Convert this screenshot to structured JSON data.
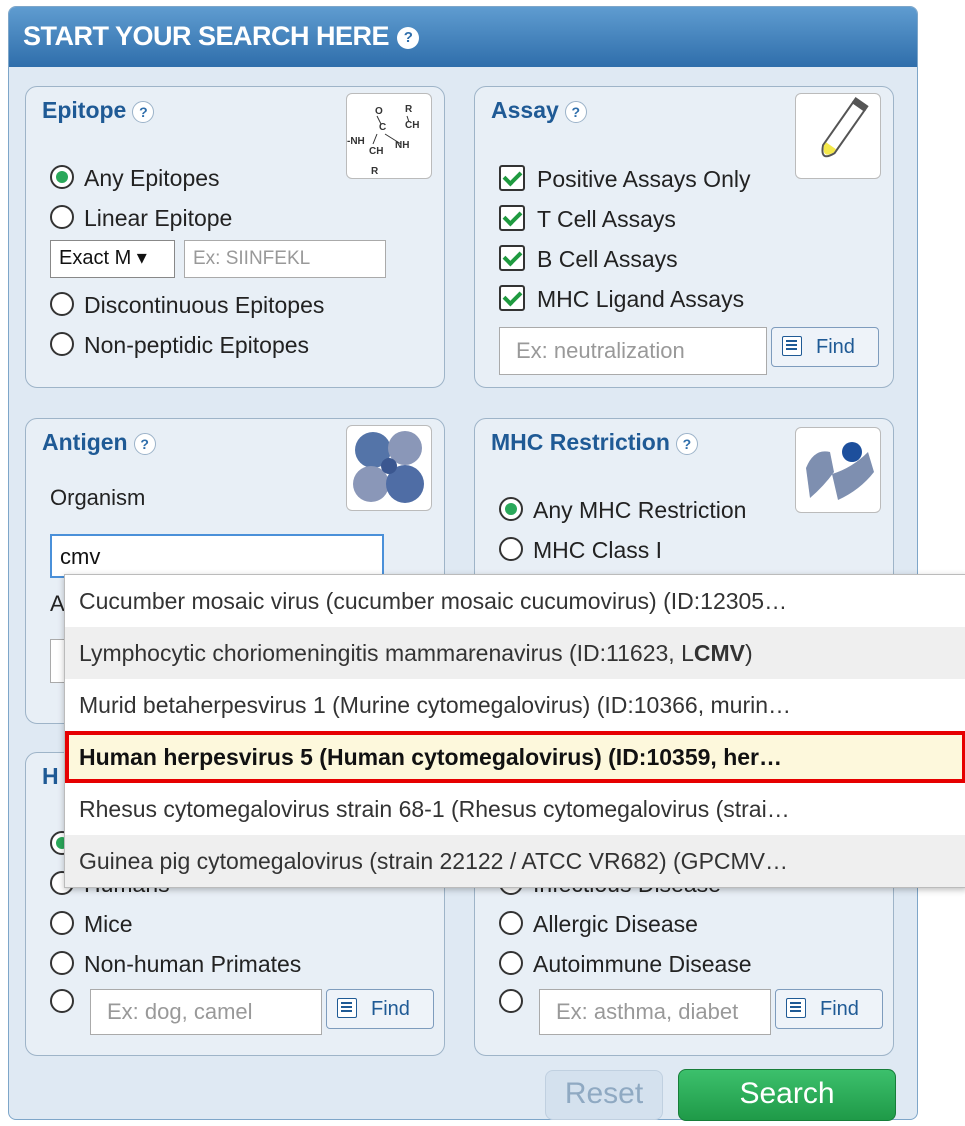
{
  "header": {
    "title": "START YOUR SEARCH HERE",
    "help": "?"
  },
  "epitope": {
    "title": "Epitope",
    "help": "?",
    "options": [
      "Any Epitopes",
      "Linear Epitope",
      "Discontinuous Epitopes",
      "Non-peptidic Epitopes"
    ],
    "selected": "Any Epitopes",
    "match_select": "Exact M ▾",
    "sequence_placeholder": "Ex: SIINFEKL"
  },
  "assay": {
    "title": "Assay",
    "help": "?",
    "checks": [
      "Positive Assays Only",
      "T Cell Assays",
      "B Cell Assays",
      "MHC Ligand Assays"
    ],
    "search_placeholder": "Ex: neutralization",
    "find_label": "Find"
  },
  "antigen": {
    "title": "Antigen",
    "help": "?",
    "organism_label": "Organism",
    "organism_value": "cmv",
    "antigen_label_fragment": "A"
  },
  "mhc": {
    "title": "MHC Restriction",
    "help": "?",
    "options": [
      "Any MHC Restriction",
      "MHC Class I"
    ],
    "selected": "Any MHC Restriction"
  },
  "host": {
    "title_fragment": "H",
    "options": [
      "Humans",
      "Mice",
      "Non-human Primates"
    ],
    "search_placeholder": "Ex: dog, camel",
    "find_label": "Find"
  },
  "disease": {
    "options": [
      "Infectious Disease",
      "Allergic Disease",
      "Autoimmune Disease"
    ],
    "search_placeholder": "Ex: asthma, diabet",
    "find_label": "Find"
  },
  "autocomplete": {
    "items": [
      {
        "text": "Cucumber mosaic virus (cucumber mosaic cucumovirus) (ID:12305…"
      },
      {
        "text_before": "Lymphocytic choriomeningitis mammarenavirus (ID:11623, L",
        "text_bold": "CMV",
        "text_after": ")"
      },
      {
        "text": "Murid betaherpesvirus 1 (Murine cytomegalovirus) (ID:10366, murin…"
      },
      {
        "text": "Human herpesvirus 5 (Human cytomegalovirus) (ID:10359, her…"
      },
      {
        "text": "Rhesus cytomegalovirus strain 68-1 (Rhesus cytomegalovirus (strai…"
      },
      {
        "text": "Guinea pig cytomegalovirus (strain 22122 / ATCC VR682) (GPCMV…"
      }
    ]
  },
  "buttons": {
    "reset": "Reset",
    "search": "Search"
  },
  "colors": {
    "header": "#2f6eab",
    "title": "#1f5a95",
    "search": "#22a04e",
    "highlight": "#e60000"
  }
}
